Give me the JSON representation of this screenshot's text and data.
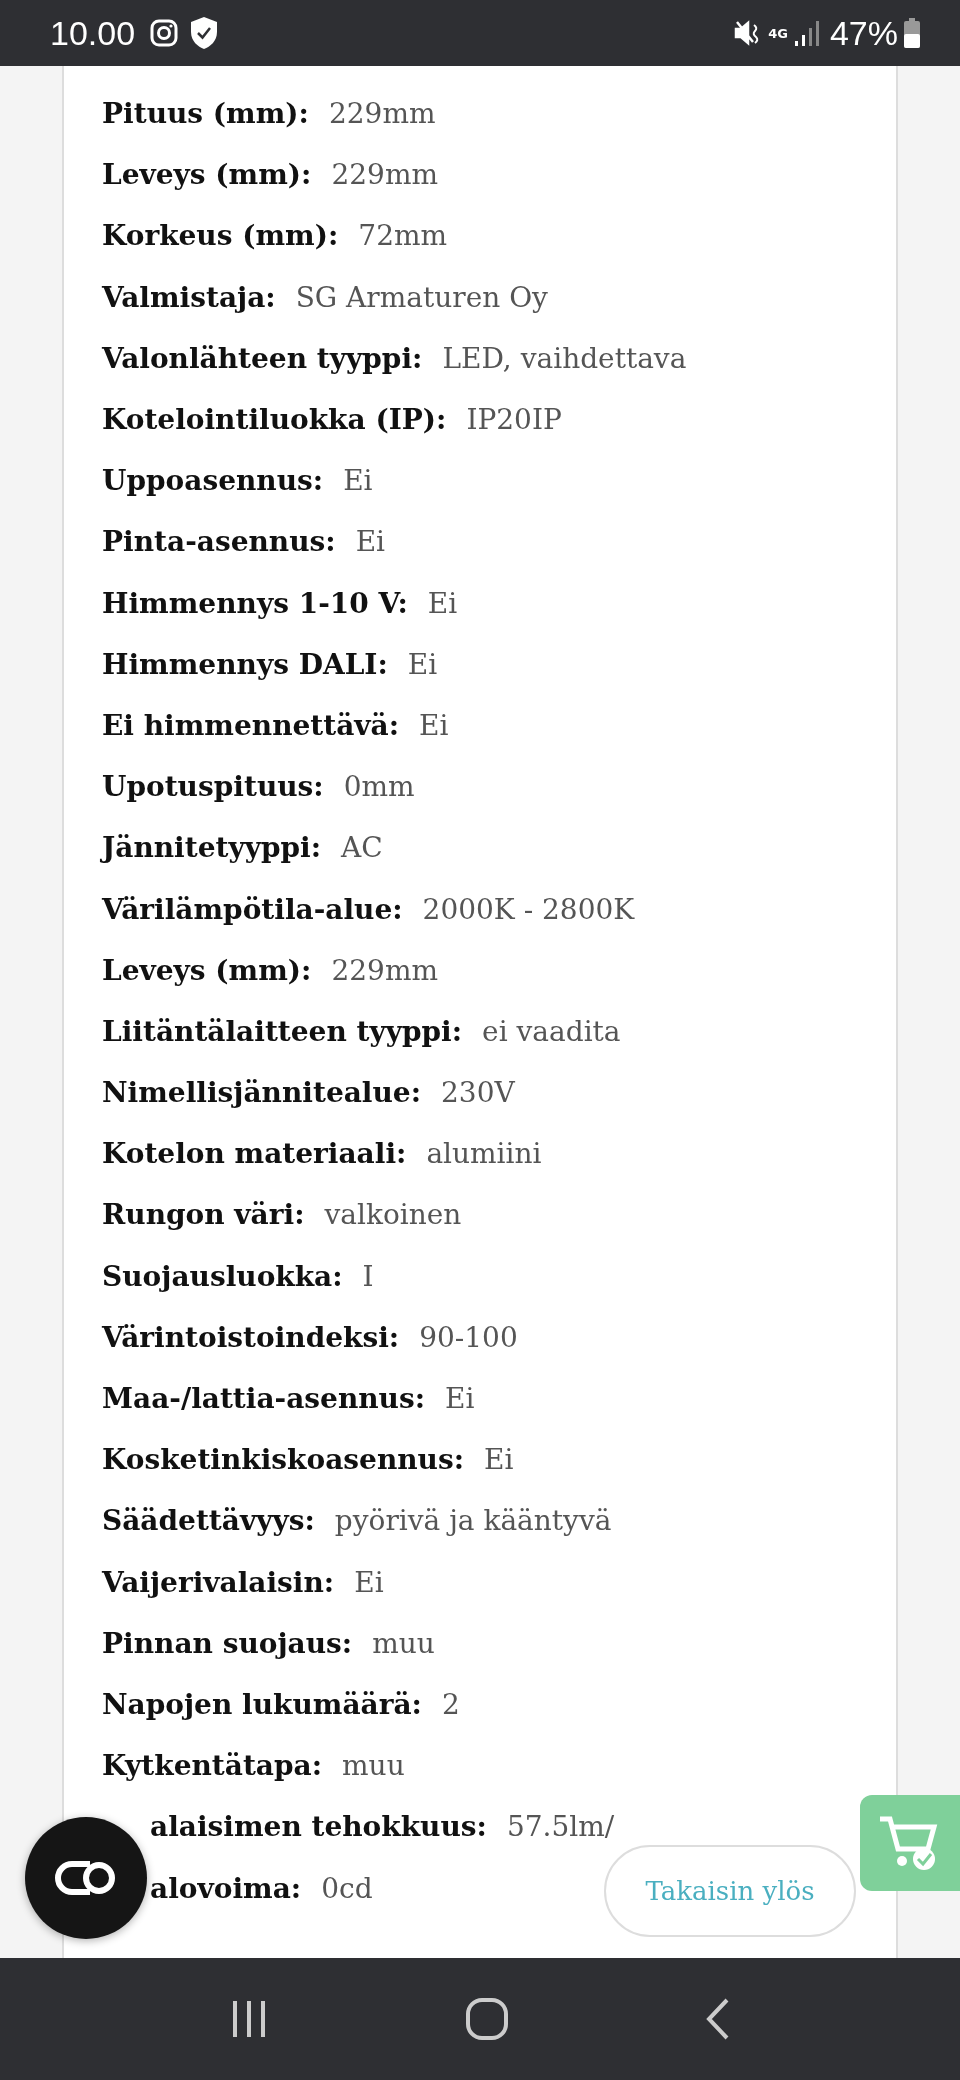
{
  "status_bar": {
    "time": "10.00",
    "network": "4G",
    "battery": "47%"
  },
  "specs": [
    {
      "label": "Pituus (mm):",
      "value": "229mm"
    },
    {
      "label": "Leveys (mm):",
      "value": "229mm"
    },
    {
      "label": "Korkeus (mm):",
      "value": "72mm"
    },
    {
      "label": "Valmistaja:",
      "value": "SG Armaturen Oy"
    },
    {
      "label": "Valonlähteen tyyppi:",
      "value": "LED, vaihdettava"
    },
    {
      "label": "Kotelointiluokka (IP):",
      "value": "IP20IP"
    },
    {
      "label": "Uppoasennus:",
      "value": "Ei"
    },
    {
      "label": "Pinta-asennus:",
      "value": "Ei"
    },
    {
      "label": "Himmennys 1-10 V:",
      "value": "Ei"
    },
    {
      "label": "Himmennys DALI:",
      "value": "Ei"
    },
    {
      "label": "Ei himmennettävä:",
      "value": "Ei"
    },
    {
      "label": "Upotuspituus:",
      "value": "0mm"
    },
    {
      "label": "Jännitetyyppi:",
      "value": "AC"
    },
    {
      "label": "Värilämpötila-alue:",
      "value": "2000K - 2800K"
    },
    {
      "label": "Leveys (mm):",
      "value": "229mm"
    },
    {
      "label": "Liitäntälaitteen tyyppi:",
      "value": "ei vaadita"
    },
    {
      "label": "Nimellisjännitealue:",
      "value": "230V"
    },
    {
      "label": "Kotelon materiaali:",
      "value": "alumiini"
    },
    {
      "label": "Rungon väri:",
      "value": "valkoinen"
    },
    {
      "label": "Suojausluokka:",
      "value": "I"
    },
    {
      "label": "Värintoistoindeksi:",
      "value": "90-100"
    },
    {
      "label": "Maa-/lattia-asennus:",
      "value": "Ei"
    },
    {
      "label": "Kosketinkiskoasennus:",
      "value": "Ei"
    },
    {
      "label": "Säädettävyys:",
      "value": "pyörivä ja kääntyvä"
    },
    {
      "label": "Vaijerivalaisin:",
      "value": "Ei"
    },
    {
      "label": "Pinnan suojaus:",
      "value": "muu"
    },
    {
      "label": "Napojen lukumäärä:",
      "value": "2"
    },
    {
      "label": "Kytkentätapa:",
      "value": "muu"
    },
    {
      "label": "alaisimen tehokkuus:",
      "value": "57.5lm/",
      "covered": true
    },
    {
      "label": "alovoima:",
      "value": "0cd",
      "covered": true
    }
  ],
  "back_to_top": "Takaisin ylös"
}
